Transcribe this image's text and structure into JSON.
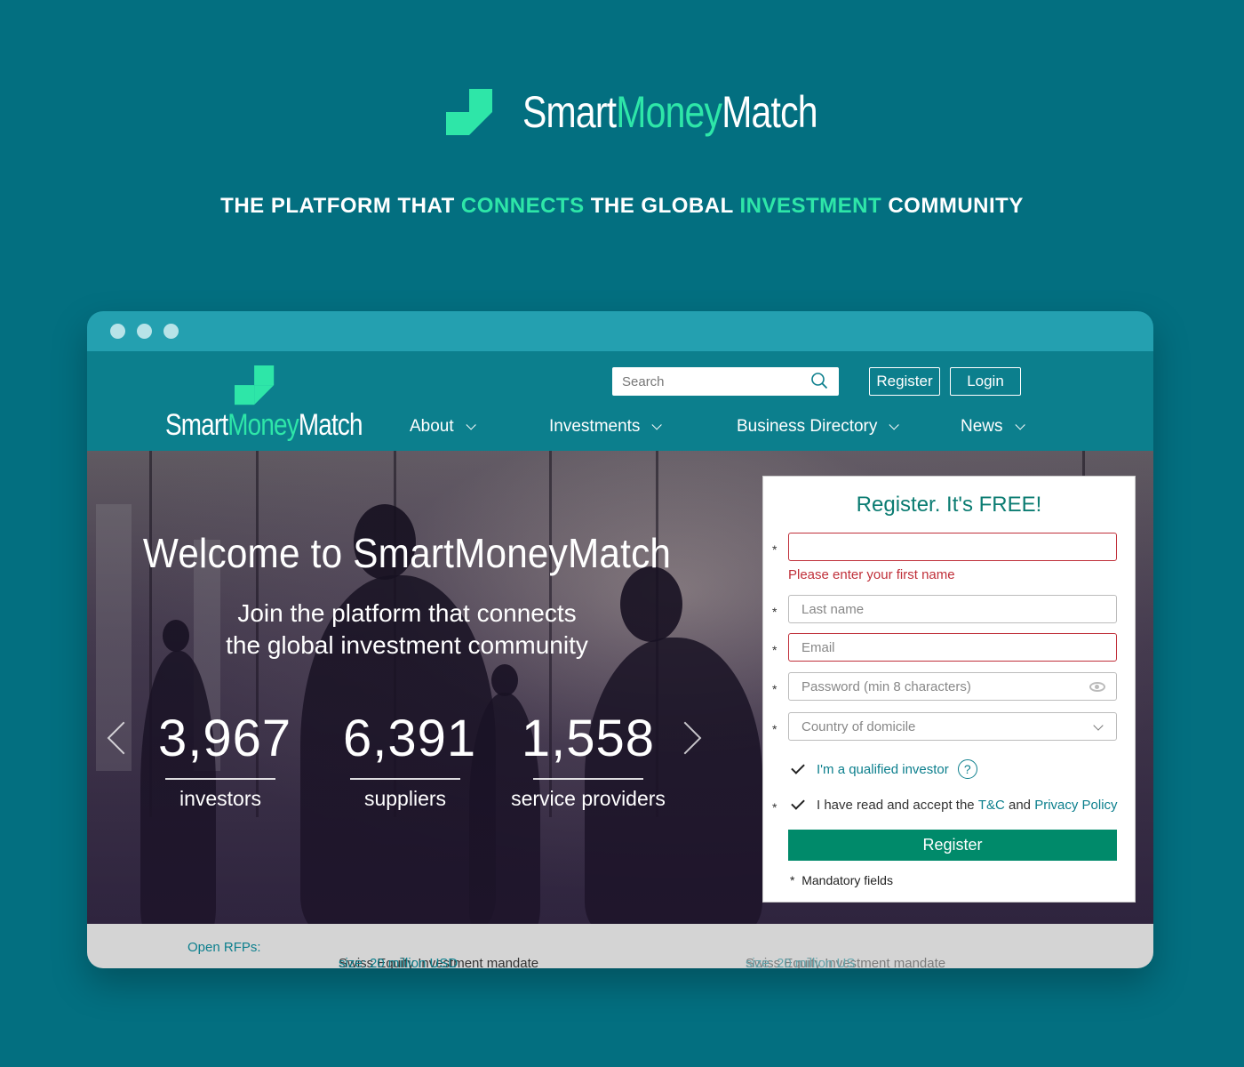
{
  "brand": {
    "smart": "Smart",
    "money": "Money",
    "match": "Match"
  },
  "tagline": {
    "p1": "THE PLATFORM THAT",
    "hl1": "CONNECTS",
    "p2": "THE GLOBAL",
    "hl2": "INVESTMENT",
    "p3": "COMMUNITY"
  },
  "colors": {
    "accent": "#2ee6a8",
    "background": "#036f80",
    "header": "#0c7f8d",
    "register_button": "#008a6a",
    "error": "#c0303a"
  },
  "header": {
    "search_placeholder": "Search",
    "register_label": "Register",
    "login_label": "Login",
    "nav": [
      {
        "label": "About"
      },
      {
        "label": "Investments"
      },
      {
        "label": "Business Directory"
      },
      {
        "label": "News"
      }
    ]
  },
  "hero": {
    "title": "Welcome to SmartMoneyMatch",
    "subtitle_line1": "Join the platform that connects",
    "subtitle_line2": "the global investment community",
    "stats": [
      {
        "value": "3,967",
        "label": "investors"
      },
      {
        "value": "6,391",
        "label": "suppliers"
      },
      {
        "value": "1,558",
        "label": "service providers"
      }
    ]
  },
  "register_form": {
    "title": "Register. It's FREE!",
    "first_name_value": "",
    "first_name_error": "Please enter your first name",
    "last_name_placeholder": "Last name",
    "email_placeholder": "Email",
    "password_placeholder": "Password (min 8 characters)",
    "country_placeholder": "Country of domicile",
    "qualified_label": "I'm a qualified investor",
    "help_glyph": "?",
    "terms_prefix": "I have read and accept the",
    "terms_link": "T&C",
    "terms_and": "and",
    "privacy_link": "Privacy Policy",
    "submit_label": "Register",
    "mandatory_note": "Mandatory fields",
    "asterisk": "*"
  },
  "ticker": {
    "label": "Open RFPs:",
    "items": [
      {
        "title": "Swiss Equity Investment mandate",
        "detail": "size: 20 million USD"
      },
      {
        "title": "Swiss Equity Investment mandate",
        "detail": "size: 20 million US"
      }
    ]
  }
}
